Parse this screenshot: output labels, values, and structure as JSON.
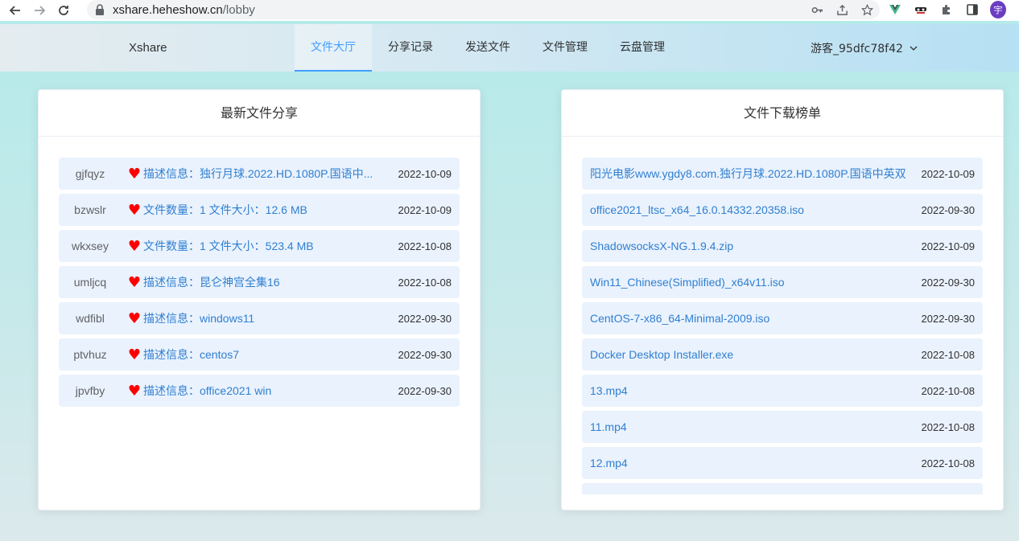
{
  "browser": {
    "url_host": "xshare.heheshow.cn",
    "url_path": "/lobby",
    "profile_initial": "宇"
  },
  "nav": {
    "brand": "Xshare",
    "tabs": [
      {
        "label": "文件大厅",
        "active": true
      },
      {
        "label": "分享记录",
        "active": false
      },
      {
        "label": "发送文件",
        "active": false
      },
      {
        "label": "文件管理",
        "active": false
      },
      {
        "label": "云盘管理",
        "active": false
      }
    ],
    "user": "游客_95dfc78f42"
  },
  "latest": {
    "title": "最新文件分享",
    "items": [
      {
        "code": "gjfqyz",
        "desc": "描述信息：独行月球.2022.HD.1080P.国语中...",
        "date": "2022-10-09"
      },
      {
        "code": "bzwslr",
        "desc": "文件数量：1 文件大小：12.6 MB",
        "date": "2022-10-09"
      },
      {
        "code": "wkxsey",
        "desc": "文件数量：1 文件大小：523.4 MB",
        "date": "2022-10-08"
      },
      {
        "code": "umljcq",
        "desc": "描述信息：昆仑神宫全集16",
        "date": "2022-10-08"
      },
      {
        "code": "wdfibl",
        "desc": "描述信息：windows11",
        "date": "2022-09-30"
      },
      {
        "code": "ptvhuz",
        "desc": "描述信息：centos7",
        "date": "2022-09-30"
      },
      {
        "code": "jpvfby",
        "desc": "描述信息：office2021 win",
        "date": "2022-09-30"
      }
    ]
  },
  "ranking": {
    "title": "文件下载榜单",
    "items": [
      {
        "name": "阳光电影www.ygdy8.com.独行月球.2022.HD.1080P.国语中英双",
        "date": "2022-10-09"
      },
      {
        "name": "office2021_ltsc_x64_16.0.14332.20358.iso",
        "date": "2022-09-30"
      },
      {
        "name": "ShadowsocksX-NG.1.9.4.zip",
        "date": "2022-10-09"
      },
      {
        "name": "Win11_Chinese(Simplified)_x64v11.iso",
        "date": "2022-09-30"
      },
      {
        "name": "CentOS-7-x86_64-Minimal-2009.iso",
        "date": "2022-09-30"
      },
      {
        "name": "Docker Desktop Installer.exe",
        "date": "2022-10-08"
      },
      {
        "name": "13.mp4",
        "date": "2022-10-08"
      },
      {
        "name": "11.mp4",
        "date": "2022-10-08"
      },
      {
        "name": "12.mp4",
        "date": "2022-10-08"
      },
      {
        "name": "",
        "date": ""
      }
    ]
  },
  "colors": {
    "accent": "#409eff",
    "link": "#2f7fd1",
    "heart": "#ff0000",
    "row_bg": "#eaf2fd"
  }
}
